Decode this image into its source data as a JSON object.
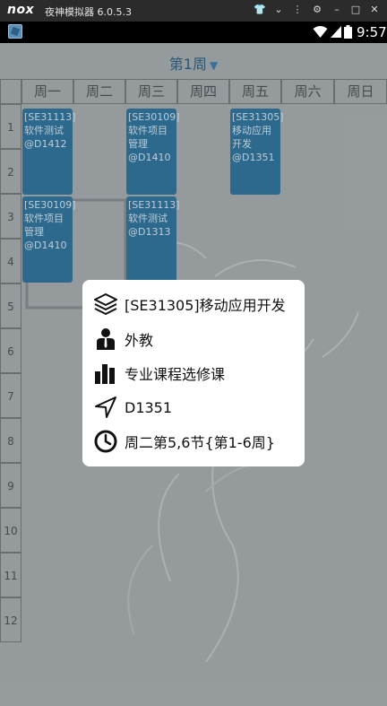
{
  "emulator": {
    "logo": "nox",
    "title": "夜神模拟器 6.0.5.3",
    "controls": [
      "👕",
      "⌄",
      "⋮",
      "⚙",
      "–",
      "□",
      "✕"
    ]
  },
  "status_bar": {
    "time": "9:57"
  },
  "schedule": {
    "week_label": "第1周",
    "days": [
      "周一",
      "周二",
      "周三",
      "周四",
      "周五",
      "周六",
      "周日"
    ],
    "periods": [
      "1",
      "2",
      "3",
      "4",
      "5",
      "6",
      "7",
      "8",
      "9",
      "10",
      "11",
      "12"
    ],
    "courses": [
      {
        "text": "[SE31113]软件测试@D1412"
      },
      {
        "text": "[SE30109]软件项目管理@D1410"
      },
      {
        "text": "[SE31305]移动应用开发@D1351"
      },
      {
        "text": "[SE30109]软件项目管理@D1410"
      },
      {
        "text": "[SE31113]软件测试@D1313"
      }
    ]
  },
  "dialog": {
    "course_title": "[SE31305]移动应用开发",
    "teacher": "外教",
    "category": "专业课程选修课",
    "location": "D1351",
    "time": "周二第5,6节{第1-6周}"
  },
  "colors": {
    "course_block": "#2f6f95",
    "week_title": "#2e5c7c",
    "dialog_bg": "#ffffff"
  }
}
